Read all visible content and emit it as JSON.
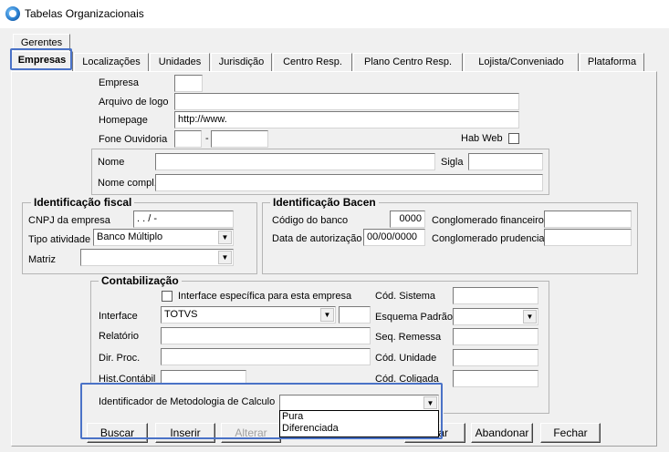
{
  "window": {
    "title": "Tabelas Organizacionais"
  },
  "tabs_row1": [
    {
      "label": "Gerentes"
    }
  ],
  "tabs_row2": [
    {
      "label": "Empresas"
    },
    {
      "label": "Localizações"
    },
    {
      "label": "Unidades"
    },
    {
      "label": "Jurisdição"
    },
    {
      "label": "Centro Resp."
    },
    {
      "label": "Plano Centro Resp."
    },
    {
      "label": "Lojista/Conveniado"
    },
    {
      "label": "Plataforma"
    }
  ],
  "top": {
    "empresa_label": "Empresa",
    "empresa_value": "",
    "arquivo_logo_label": "Arquivo de logo",
    "arquivo_logo_value": "",
    "homepage_label": "Homepage",
    "homepage_value": "http://www.",
    "fone_label": "Fone Ouvidoria",
    "fone_ddd": "",
    "fone_sep": "-",
    "fone_num": "",
    "hab_web_label": "Hab Web",
    "nome_label": "Nome",
    "nome_value": "",
    "sigla_label": "Sigla",
    "sigla_value": "",
    "nome_compl_label": "Nome compl.",
    "nome_compl_value": ""
  },
  "fiscal": {
    "title": "Identificação fiscal",
    "cnpj_label": "CNPJ da empresa",
    "cnpj_value": ".   .   /   -",
    "tipo_label": "Tipo atividade",
    "tipo_value": "Banco Múltiplo",
    "matriz_label": "Matriz",
    "matriz_value": ""
  },
  "bacen": {
    "title": "Identificação Bacen",
    "codigo_label": "Código do banco",
    "codigo_value": "0000",
    "data_label": "Data de autorização",
    "data_value": "00/00/0000",
    "cong_fin_label": "Conglomerado financeiro",
    "cong_fin_value": "",
    "cong_prud_label": "Conglomerado prudencial",
    "cong_prud_value": ""
  },
  "contab": {
    "title": "Contabilização",
    "interface_especifica_label": "Interface específica para esta empresa",
    "interface_label": "Interface",
    "interface_value": "TOTVS",
    "interface_extra": "",
    "relatorio_label": "Relatório",
    "relatorio_value": "",
    "dir_proc_label": "Dir. Proc.",
    "dir_proc_value": "",
    "hist_label": "Hist.Contábil",
    "hist_value": "",
    "cod_sistema_label": "Cód. Sistema",
    "cod_sistema_value": "",
    "esquema_label": "Esquema Padrão",
    "esquema_value": "",
    "seq_label": "Seq. Remessa",
    "seq_value": "",
    "cod_unidade_label": "Cód. Unidade",
    "cod_unidade_value": "",
    "cod_coligada_label": "Cód. Coligada",
    "cod_coligada_value": "",
    "metodologia_label": "Identificador de Metodologia de Calculo",
    "metodologia_value": "",
    "metodologia_options": [
      "Pura",
      "Diferenciada"
    ]
  },
  "buttons": {
    "buscar": "Buscar",
    "inserir": "Inserir",
    "alterar": "Alterar",
    "salvar_partial": "lvar",
    "abandonar": "Abandonar",
    "fechar": "Fechar"
  },
  "icons": {
    "app": "app-globe-icon",
    "dropdown": "chevron-down-icon"
  },
  "colors": {
    "highlight": "#4a72c7",
    "panel_bg": "#f0f0f0"
  }
}
